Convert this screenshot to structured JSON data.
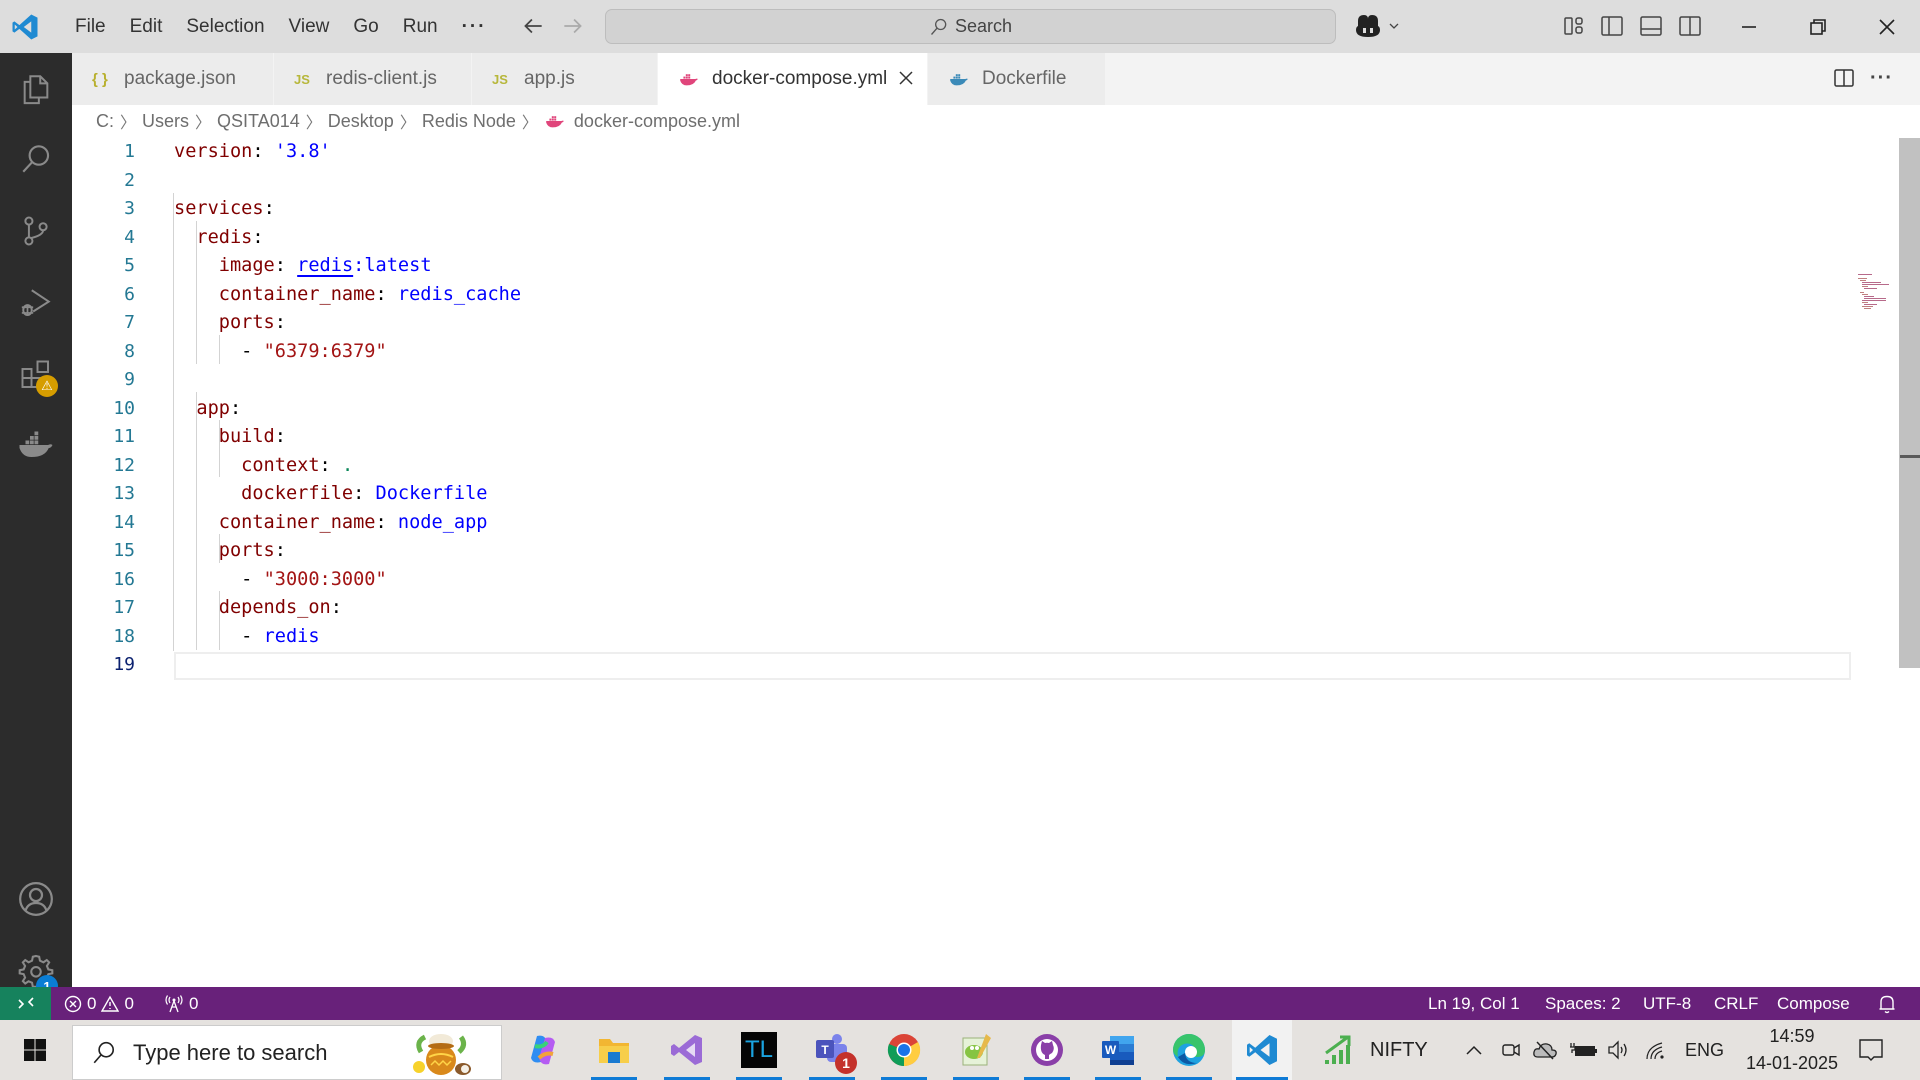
{
  "titlebar": {
    "menu": [
      "File",
      "Edit",
      "Selection",
      "View",
      "Go",
      "Run",
      "···"
    ],
    "search_placeholder": "Search",
    "window_controls": [
      "minimize-icon",
      "restore-icon",
      "close-icon"
    ],
    "layout_icons": [
      "customize-layout-icon",
      "toggle-primary-sidebar-icon",
      "toggle-panel-icon",
      "toggle-secondary-sidebar-icon"
    ]
  },
  "activity_bar": {
    "items": [
      {
        "name": "explorer",
        "icon": "files-icon"
      },
      {
        "name": "search",
        "icon": "search-icon"
      },
      {
        "name": "source-control",
        "icon": "source-control-icon"
      },
      {
        "name": "run-and-debug",
        "icon": "run-debug-icon"
      },
      {
        "name": "extensions",
        "icon": "extensions-icon",
        "badge": "⚠"
      },
      {
        "name": "docker",
        "icon": "docker-icon"
      }
    ],
    "bottom": [
      {
        "name": "accounts",
        "icon": "account-icon"
      },
      {
        "name": "manage",
        "icon": "gear-icon",
        "badge": "1"
      }
    ]
  },
  "tabs": [
    {
      "label": "package.json",
      "icon": "{ }",
      "icon_name": "json-icon",
      "active": false
    },
    {
      "label": "redis-client.js",
      "icon": "JS",
      "icon_name": "js-icon",
      "active": false
    },
    {
      "label": "app.js",
      "icon": "JS",
      "icon_name": "js-icon",
      "active": false
    },
    {
      "label": "docker-compose.yml",
      "icon": "docker",
      "icon_name": "docker-compose-icon",
      "active": true
    },
    {
      "label": "Dockerfile",
      "icon": "docker",
      "icon_name": "dockerfile-icon",
      "active": false
    }
  ],
  "breadcrumb": [
    "C:",
    "Users",
    "QSITA014",
    "Desktop",
    "Redis Node",
    "docker-compose.yml"
  ],
  "editor": {
    "language": "yaml",
    "current_line": 19,
    "lines": [
      "version: '3.8'",
      "",
      "services:",
      "  redis:",
      "    image: redis:latest",
      "    container_name: redis_cache",
      "    ports:",
      "      - \"6379:6379\"",
      "",
      "  app:",
      "    build:",
      "      context: .",
      "      dockerfile: Dockerfile",
      "    container_name: node_app",
      "    ports:",
      "      - \"3000:3000\"",
      "    depends_on:",
      "      - redis",
      ""
    ],
    "line_numbers": [
      "1",
      "2",
      "3",
      "4",
      "5",
      "6",
      "7",
      "8",
      "9",
      "10",
      "11",
      "12",
      "13",
      "14",
      "15",
      "16",
      "17",
      "18",
      "19"
    ]
  },
  "statusbar": {
    "errors": "0",
    "warnings": "0",
    "ports": "0",
    "position": "Ln 19, Col 1",
    "indent": "Spaces: 2",
    "encoding": "UTF-8",
    "eol": "CRLF",
    "language_mode": "Compose",
    "colors": {
      "background": "#68217a",
      "remote": "#16825d"
    }
  },
  "taskbar": {
    "search_placeholder": "Type here to search",
    "apps": [
      {
        "name": "copilot"
      },
      {
        "name": "file-explorer"
      },
      {
        "name": "visual-studio"
      },
      {
        "name": "tl-app",
        "label": "TL"
      },
      {
        "name": "teams",
        "badge": "1"
      },
      {
        "name": "chrome"
      },
      {
        "name": "notepad-plus-plus"
      },
      {
        "name": "github-desktop"
      },
      {
        "name": "word",
        "label": "W"
      },
      {
        "name": "edge"
      },
      {
        "name": "vscode",
        "active": true
      }
    ],
    "widget_label": "NIFTY",
    "language": "ENG",
    "time": "14:59",
    "date": "14-01-2025"
  }
}
